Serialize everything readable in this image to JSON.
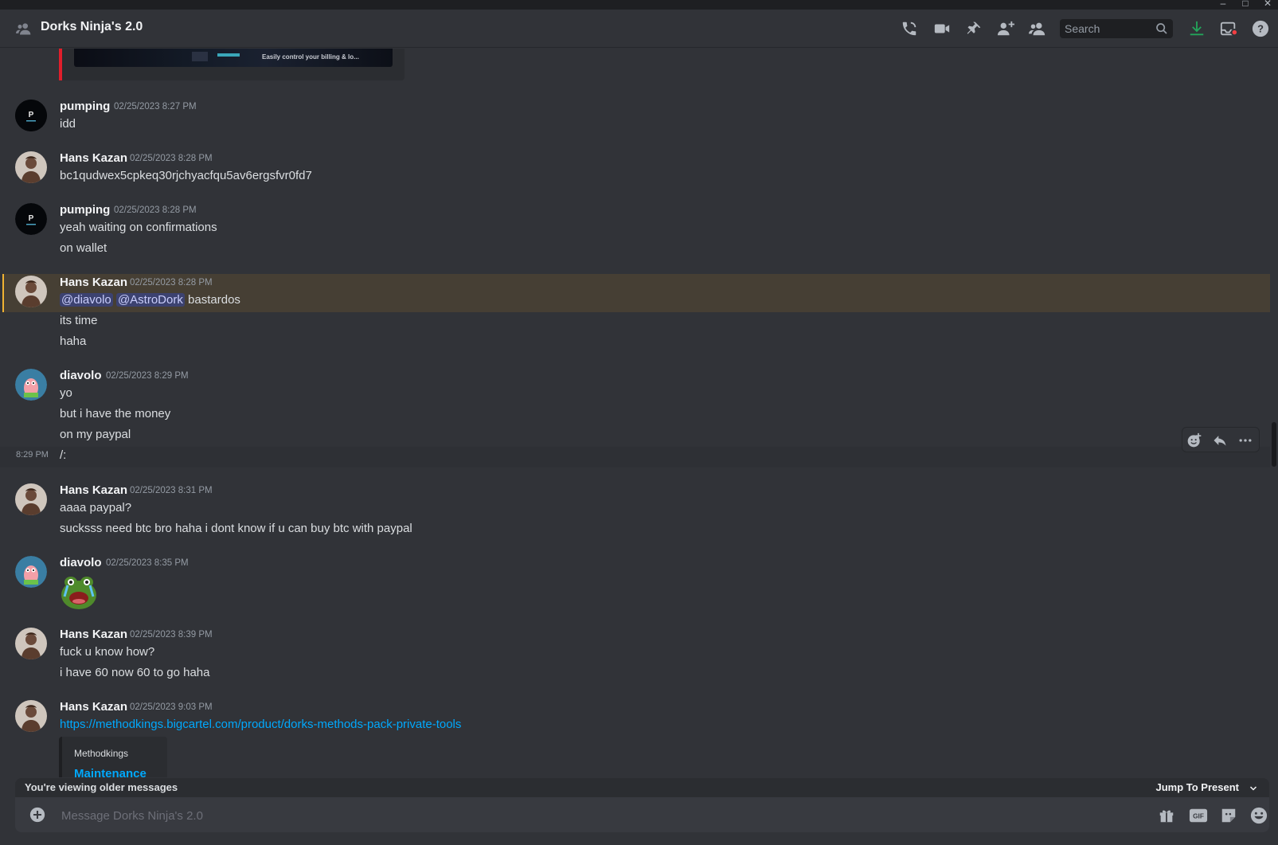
{
  "window": {
    "controls": [
      "–",
      "□",
      "✕"
    ]
  },
  "header": {
    "title": "Dorks Ninja's 2.0",
    "search_placeholder": "Search"
  },
  "embed_top": {
    "image_text": "Easily control your billing & lo..."
  },
  "messages": [
    {
      "author": "pumping",
      "timestamp": "02/25/2023 8:27 PM",
      "lines": [
        "idd"
      ]
    },
    {
      "author": "Hans Kazan",
      "timestamp": "02/25/2023 8:28 PM",
      "lines": [
        "bc1qudwex5cpkeq30rjchyacfqu5av6ergsfvr0fd7"
      ]
    },
    {
      "author": "pumping",
      "timestamp": "02/25/2023 8:28 PM",
      "lines": [
        "yeah waiting on confirmations",
        "on wallet"
      ]
    },
    {
      "author": "Hans Kazan",
      "timestamp": "02/25/2023 8:28 PM",
      "mentions": [
        "@diavolo",
        "@AstroDork"
      ],
      "first_line_rest": "bastardos",
      "lines": [
        "its time",
        "haha"
      ]
    },
    {
      "author": "diavolo",
      "timestamp": "02/25/2023 8:29 PM",
      "lines": [
        "yo",
        "but i have the money",
        "on my paypal",
        "/:"
      ],
      "hover_time": "8:29 PM"
    },
    {
      "author": "Hans Kazan",
      "timestamp": "02/25/2023 8:31 PM",
      "lines": [
        "aaaa paypal?",
        "sucksss need btc bro haha i dont know if u can buy btc with paypal"
      ]
    },
    {
      "author": "diavolo",
      "timestamp": "02/25/2023 8:35 PM",
      "lines": []
    },
    {
      "author": "Hans Kazan",
      "timestamp": "02/25/2023 8:39 PM",
      "lines": [
        "fuck u know how?",
        "i have 60 now 60 to go haha"
      ]
    },
    {
      "author": "Hans Kazan",
      "timestamp": "02/25/2023 9:03 PM",
      "link": "https://methodkings.bigcartel.com/product/dorks-methods-pack-private-tools",
      "embed_provider": "Methodkings",
      "embed_title": "Maintenance"
    }
  ],
  "older_bar": {
    "text": "You're viewing older messages",
    "jump": "Jump To Present"
  },
  "composer": {
    "placeholder": "Message Dorks Ninja's 2.0"
  },
  "colors": {
    "background": "#313338",
    "accent_link": "#00a8fc",
    "highlight": "#463f34",
    "download": "#23a55a"
  }
}
